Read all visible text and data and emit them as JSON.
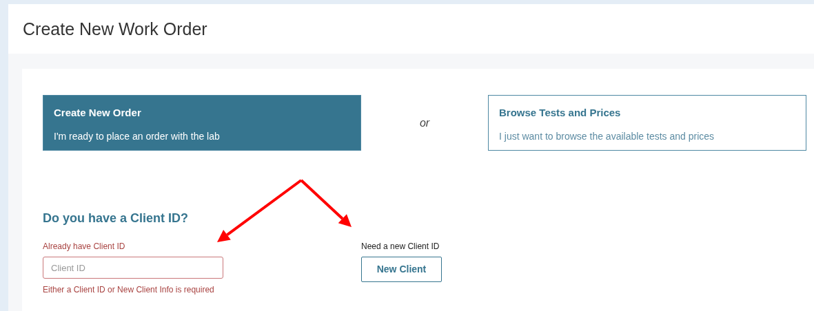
{
  "page": {
    "title": "Create New Work Order"
  },
  "options": [
    {
      "title": "Create New Order",
      "description": "I'm ready to place an order with the lab",
      "selected": true
    },
    {
      "title": "Browse Tests and Prices",
      "description": "I just want to browse the available tests and prices",
      "selected": false
    }
  ],
  "separator": "or",
  "client_section": {
    "heading": "Do you have a Client ID?",
    "existing": {
      "label": "Already have Client ID",
      "placeholder": "Client ID",
      "error": "Either a Client ID or New Client Info is required"
    },
    "new": {
      "label": "Need a new Client ID",
      "button": "New Client"
    }
  },
  "annotations": [
    {
      "kind": "arrow"
    },
    {
      "kind": "arrow"
    }
  ]
}
